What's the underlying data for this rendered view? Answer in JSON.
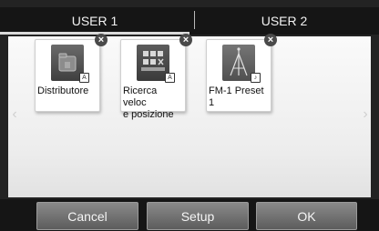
{
  "tabs": [
    {
      "label": "USER 1",
      "active": true
    },
    {
      "label": "USER 2",
      "active": false
    }
  ],
  "shortcuts": [
    {
      "label": "Distributore",
      "icon": "folder-icon"
    },
    {
      "label": "Ricerca veloc\ne posizione",
      "icon": "position-search-icon"
    },
    {
      "label": "FM-1 Preset\n1",
      "icon": "radio-antenna-icon"
    }
  ],
  "remove_glyph": "×",
  "buttons": {
    "cancel": "Cancel",
    "setup": "Setup",
    "ok": "OK"
  },
  "colors": {
    "panel_bg": "#f5f5f5",
    "bar_bg": "#151515",
    "button_gradient_top": "#8a8a8a",
    "button_gradient_bottom": "#5c5c5c"
  }
}
